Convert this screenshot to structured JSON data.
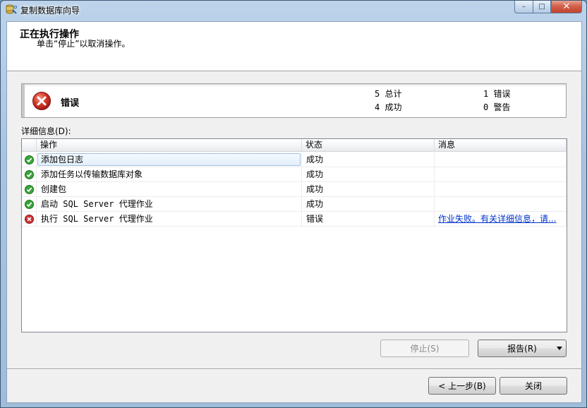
{
  "window": {
    "title": "复制数据库向导",
    "controls": {
      "minimize": "–",
      "maximize": "□",
      "close": "✕"
    }
  },
  "header": {
    "title": "正在执行操作",
    "subtitle": "单击“停止”以取消操作。"
  },
  "status": {
    "label": "错误",
    "icon": "error-icon",
    "total": "5 总计",
    "success": "4 成功",
    "errors": "1 错误",
    "warnings": "0 警告"
  },
  "details": {
    "label": "详细信息(D):",
    "columns": {
      "action": "操作",
      "state": "状态",
      "message": "消息"
    },
    "rows": [
      {
        "icon": "success-icon",
        "action": "添加包日志",
        "state": "成功",
        "message": "",
        "selected": true
      },
      {
        "icon": "success-icon",
        "action": "添加任务以传输数据库对象",
        "state": "成功",
        "message": ""
      },
      {
        "icon": "success-icon",
        "action": "创建包",
        "state": "成功",
        "message": ""
      },
      {
        "icon": "success-icon",
        "action": "启动 SQL Server 代理作业",
        "state": "成功",
        "message": ""
      },
      {
        "icon": "error-icon",
        "action": "执行 SQL Server 代理作业",
        "state": "错误",
        "message": "作业失败。有关详细信息，请..."
      }
    ]
  },
  "buttons": {
    "stop": "停止(S)",
    "report": "报告(R)",
    "back": "< 上一步(B)",
    "close": "关闭"
  },
  "colors": {
    "success": "#3aa53a",
    "error": "#d13434",
    "link": "#0033cc"
  }
}
